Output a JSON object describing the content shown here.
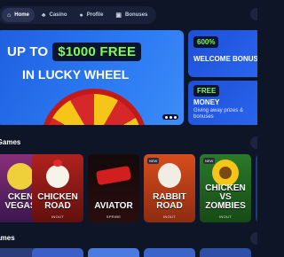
{
  "nav": {
    "items": [
      {
        "label": "Home",
        "icon": "home-icon",
        "glyph": "⌂"
      },
      {
        "label": "Casino",
        "icon": "casino-icon",
        "glyph": "♣"
      },
      {
        "label": "Profile",
        "icon": "profile-icon",
        "glyph": "●"
      },
      {
        "label": "Bonuses",
        "icon": "gift-icon",
        "glyph": "▣"
      }
    ]
  },
  "hero": {
    "line1_prefix": "UP TO",
    "amount": "$1000 FREE",
    "line2": "IN LUCKY WHEEL"
  },
  "promos": [
    {
      "badge": "600%",
      "title": "WELCOME BONUS",
      "subtitle": ""
    },
    {
      "badge": "FREE",
      "title": "MONEY",
      "subtitle": "Giving away prizes & bonuses"
    }
  ],
  "sections": {
    "first_title": "k Games",
    "second_title": "Games"
  },
  "games": [
    {
      "name": "CKEN VEGAS",
      "maker": "",
      "is_new": false
    },
    {
      "name": "CHICKEN ROAD",
      "maker": "INOUT",
      "is_new": false
    },
    {
      "name": "AVIATOR",
      "maker": "SPRIBE",
      "is_new": false
    },
    {
      "name": "RABBIT ROAD",
      "maker": "INOUT",
      "is_new": true
    },
    {
      "name": "CHICKEN VS ZOMBIES",
      "maker": "INOUT",
      "is_new": true
    }
  ],
  "colors": {
    "background": "#0e1526",
    "accent_green": "#7dff4a",
    "banner_blue": "#2b78f2"
  }
}
